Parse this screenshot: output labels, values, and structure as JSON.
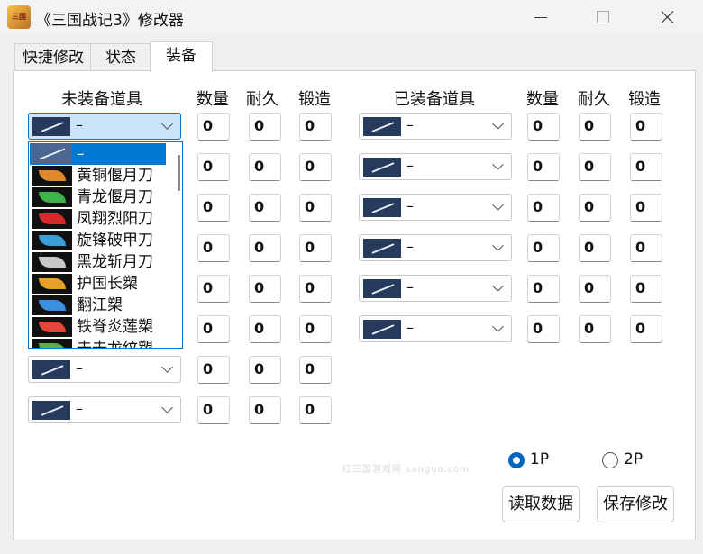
{
  "window": {
    "icon_text": "三国",
    "title": "《三国战记3》修改器"
  },
  "tabs": [
    {
      "label": "快捷修改"
    },
    {
      "label": "状态"
    },
    {
      "label": "装备"
    }
  ],
  "unequipped": {
    "header": "未装备道具",
    "col_qty": "数量",
    "col_dur": "耐久",
    "col_forge": "锻造",
    "rows": [
      {
        "item": "–",
        "qty": "0",
        "dur": "0",
        "forge": "0"
      },
      {
        "item": "–",
        "qty": "0",
        "dur": "0",
        "forge": "0"
      },
      {
        "item": "–",
        "qty": "0",
        "dur": "0",
        "forge": "0"
      },
      {
        "item": "–",
        "qty": "0",
        "dur": "0",
        "forge": "0"
      },
      {
        "item": "–",
        "qty": "0",
        "dur": "0",
        "forge": "0"
      },
      {
        "item": "–",
        "qty": "0",
        "dur": "0",
        "forge": "0"
      },
      {
        "item": "–",
        "qty": "0",
        "dur": "0",
        "forge": "0"
      },
      {
        "item": "–",
        "qty": "0",
        "dur": "0",
        "forge": "0"
      }
    ]
  },
  "equipped": {
    "header": "已装备道具",
    "col_qty": "数量",
    "col_dur": "耐久",
    "col_forge": "锻造",
    "rows": [
      {
        "item": "–",
        "qty": "0",
        "dur": "0",
        "forge": "0"
      },
      {
        "item": "–",
        "qty": "0",
        "dur": "0",
        "forge": "0"
      },
      {
        "item": "–",
        "qty": "0",
        "dur": "0",
        "forge": "0"
      },
      {
        "item": "–",
        "qty": "0",
        "dur": "0",
        "forge": "0"
      },
      {
        "item": "–",
        "qty": "0",
        "dur": "0",
        "forge": "0"
      },
      {
        "item": "–",
        "qty": "0",
        "dur": "0",
        "forge": "0"
      }
    ]
  },
  "dropdown": {
    "options": [
      {
        "label": "–",
        "icon": "sword-icon",
        "color": "#4a6794"
      },
      {
        "label": "黄铜偃月刀",
        "icon": "blade-icon",
        "color": "#e0892a"
      },
      {
        "label": "青龙偃月刀",
        "icon": "blade-icon",
        "color": "#3db34a"
      },
      {
        "label": "凤翔烈阳刀",
        "icon": "blade-icon",
        "color": "#d62a2a"
      },
      {
        "label": "旋锋破甲刀",
        "icon": "blade-icon",
        "color": "#3a9fd6"
      },
      {
        "label": "黑龙斩月刀",
        "icon": "blade-icon",
        "color": "#c8c8c8"
      },
      {
        "label": "护国长槊",
        "icon": "spear-icon",
        "color": "#e6a126"
      },
      {
        "label": "翻江槊",
        "icon": "spear-icon",
        "color": "#3a8fe0"
      },
      {
        "label": "铁脊炎莲槊",
        "icon": "spear-icon",
        "color": "#e0463a"
      },
      {
        "label": "去去龙纹槊",
        "icon": "spear-icon",
        "color": "#5fae4a"
      }
    ]
  },
  "player": {
    "option_1": "1P",
    "option_2": "2P",
    "selected": "1P"
  },
  "buttons": {
    "read": "读取数据",
    "save": "保存修改"
  },
  "watermark": "红三国游戏网 sanguo.com",
  "colors": {
    "accent": "#0078d4",
    "selection": "#0078d4",
    "combo_focus": "#cce4f7"
  }
}
